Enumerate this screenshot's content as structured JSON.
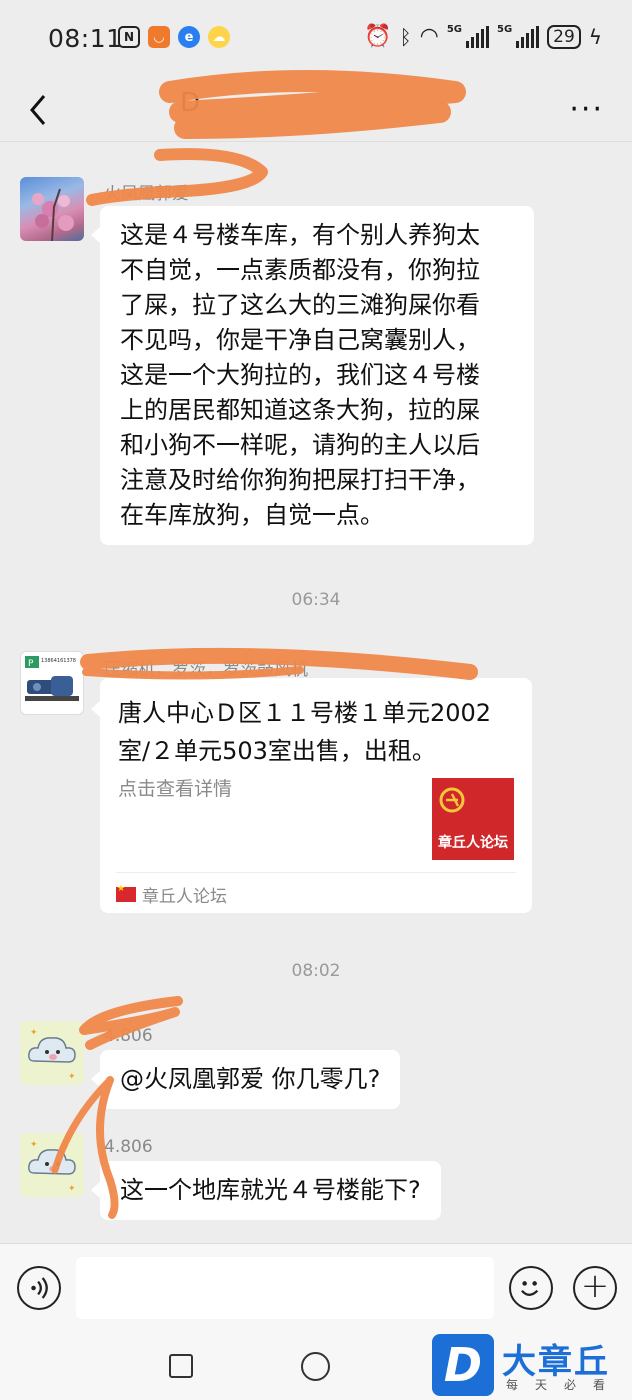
{
  "status_bar": {
    "time": "08:11",
    "net1": "5G",
    "net2": "5G",
    "battery": "29"
  },
  "header": {
    "title": "D"
  },
  "messages": [
    {
      "sender": "火凤凰郭爱",
      "lines": [
        "这是４号楼车库，有个别人养狗太",
        "不自觉，一点素质都没有，你狗拉",
        "了屎，拉了这么大的三滩狗屎你看",
        "不见吗，你是干净自己窝囊别人，",
        "这是一个大狗拉的，我们这４号楼",
        "上的居民都知道这条大狗，拉的屎",
        "和小狗不一样呢，请狗的主人以后",
        "注意及时给你狗狗把屎打扫干净，",
        "在车库放狗，自觉一点。"
      ]
    },
    {
      "time": "06:34"
    },
    {
      "sender": "压缩机，罗茨，罗茨鼓风机",
      "avatar_text": "13864161378",
      "card": {
        "title_lines": [
          "唐人中心Ｄ区１１号楼１单元2002",
          "室/２单元503室出售，出租。"
        ],
        "desc": "点击查看详情",
        "thumb_text": "章丘人论坛",
        "source": "章丘人论坛"
      }
    },
    {
      "time": "08:02"
    },
    {
      "sender": "4.806",
      "text": "@火凤凰郭爱  你几零几?"
    },
    {
      "sender": "4.806",
      "text": "这一个地库就光４号楼能下?"
    }
  ],
  "input_bar": {
    "placeholder": ""
  },
  "watermark": {
    "letter": "D",
    "name": "大章丘",
    "sub": "每天必看"
  }
}
